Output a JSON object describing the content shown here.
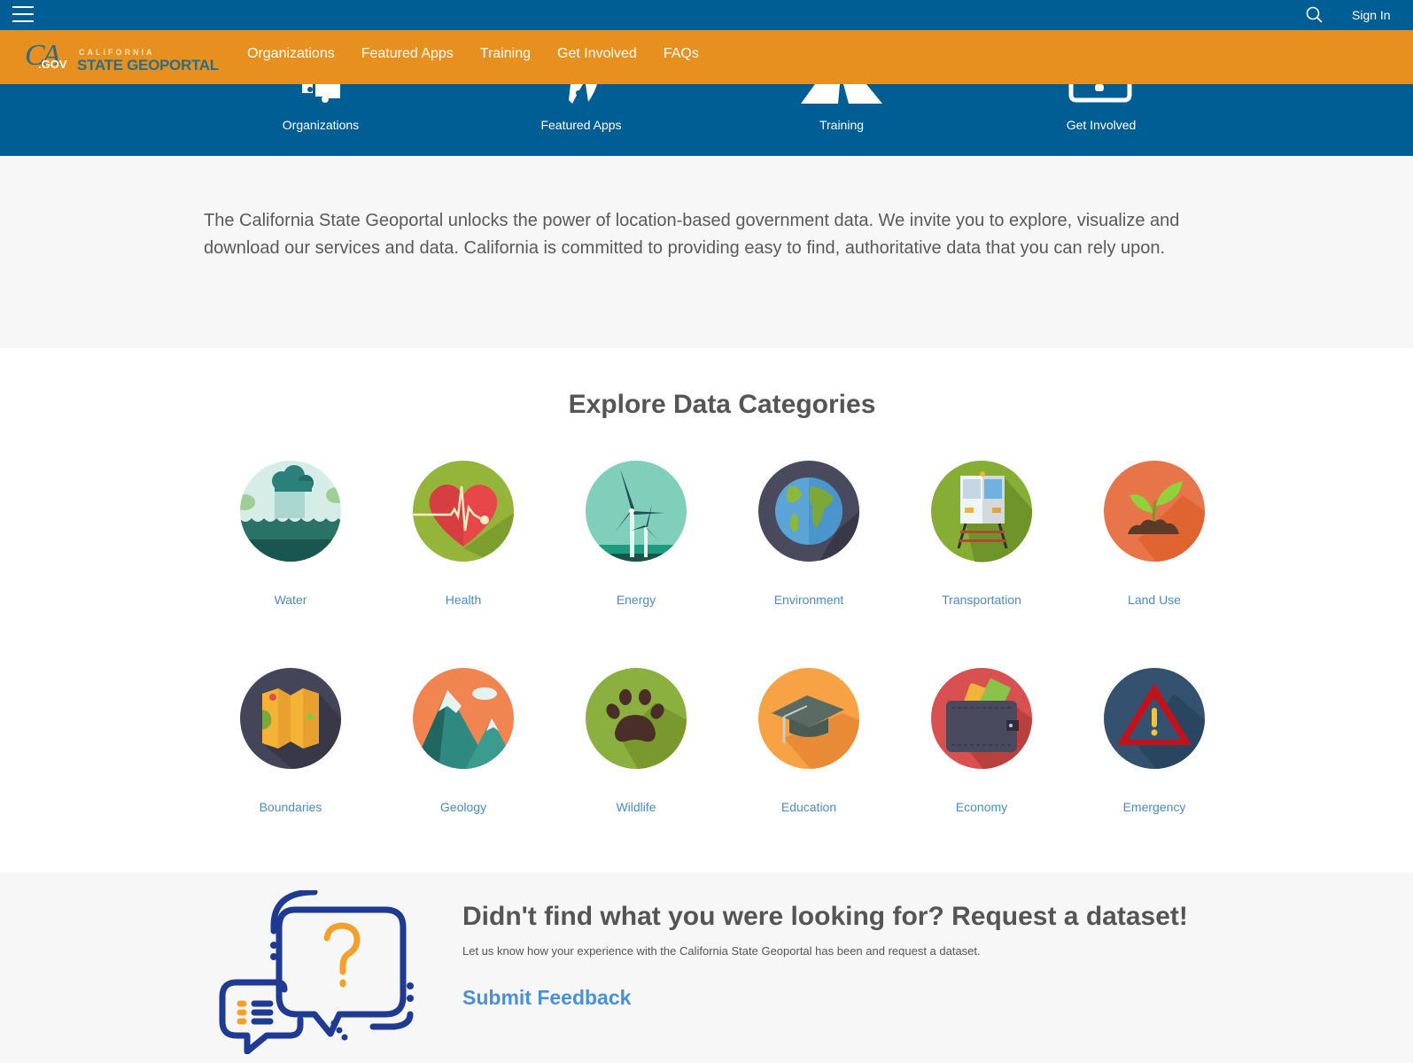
{
  "topbar": {
    "menu_icon": "hamburger-menu-icon",
    "search_icon": "search-icon",
    "signin_label": "Sign In"
  },
  "brand": {
    "ca": "CA",
    "gov": ".GOV",
    "california": "CALIFORNIA",
    "name": "STATE GEOPORTAL"
  },
  "nav": {
    "items": [
      "Organizations",
      "Featured Apps",
      "Training",
      "Get Involved",
      "FAQs"
    ]
  },
  "hero": {
    "items": [
      {
        "label": "Organizations",
        "icon": "puzzle-icon"
      },
      {
        "label": "Featured Apps",
        "icon": "rocket-icon"
      },
      {
        "label": "Training",
        "icon": "road-icon"
      },
      {
        "label": "Get Involved",
        "icon": "inbox-icon"
      }
    ]
  },
  "intro": {
    "text": "The California State Geoportal unlocks the power of location-based government data. We invite you to explore, visualize and download our services and data. California is committed to providing easy to find, authoritative data that you can rely upon."
  },
  "explore": {
    "title": "Explore Data Categories",
    "categories": [
      {
        "label": "Water",
        "icon": "water-icon",
        "color": "#d6ece6"
      },
      {
        "label": "Health",
        "icon": "heart-icon",
        "color": "#94b53a"
      },
      {
        "label": "Energy",
        "icon": "wind-turbine-icon",
        "color": "#7fcfba"
      },
      {
        "label": "Environment",
        "icon": "globe-icon",
        "color": "#4a4a5e"
      },
      {
        "label": "Transportation",
        "icon": "train-icon",
        "color": "#86ae35"
      },
      {
        "label": "Land Use",
        "icon": "sprout-icon",
        "color": "#e8744a"
      },
      {
        "label": "Boundaries",
        "icon": "map-icon",
        "color": "#45455a"
      },
      {
        "label": "Geology",
        "icon": "mountain-icon",
        "color": "#f08552"
      },
      {
        "label": "Wildlife",
        "icon": "paw-icon",
        "color": "#8bb040"
      },
      {
        "label": "Education",
        "icon": "graduation-cap-icon",
        "color": "#f7a244"
      },
      {
        "label": "Economy",
        "icon": "wallet-icon",
        "color": "#d8504f"
      },
      {
        "label": "Emergency",
        "icon": "warning-icon",
        "color": "#34526f"
      }
    ]
  },
  "feedback": {
    "title": "Didn't find what you were looking for? Request a dataset!",
    "description": "Let us know how your experience with the California State Geoportal has been and request a dataset.",
    "link_label": "Submit Feedback",
    "illustration": "chat-bubbles-question-icon"
  },
  "colors": {
    "primary_blue": "#005e95",
    "accent_orange": "#e8901f",
    "link_blue": "#4c8ac8"
  }
}
